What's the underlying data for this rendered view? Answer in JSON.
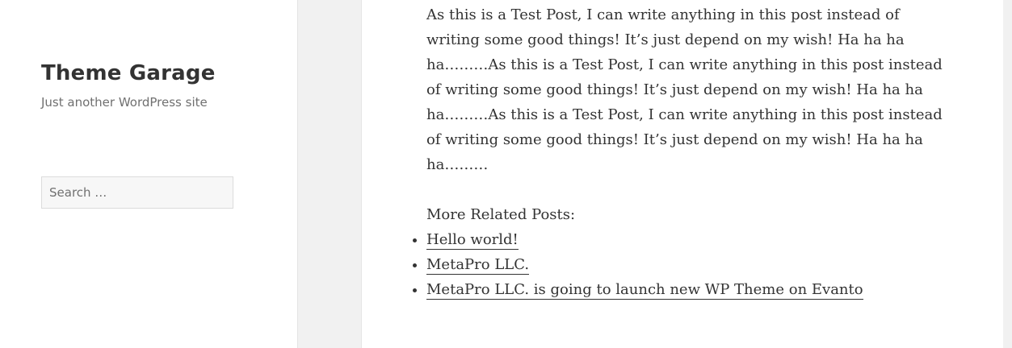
{
  "site": {
    "title": "Theme Garage",
    "description": "Just another WordPress site"
  },
  "search": {
    "placeholder": "Search …"
  },
  "post": {
    "paragraph": "As this is a Test Post, I can write anything in this post instead of writing some good things! It’s just depend on my wish! Ha ha ha ha………As this is a Test Post, I can write anything in this post instead of writing some good things! It’s just depend on my wish! Ha ha ha ha………As this is a Test Post, I can write anything in this post instead of writing some good things! It’s just depend on my wish! Ha ha ha ha………",
    "related_heading": "More Related Posts:",
    "related": [
      {
        "label": "Hello world!"
      },
      {
        "label": "MetaPro LLC."
      },
      {
        "label": "MetaPro LLC. is going to launch new WP Theme on Evanto"
      }
    ]
  },
  "colors": {
    "background": "#f1f1f1",
    "panel": "#ffffff",
    "text": "#333333",
    "muted": "#707070"
  }
}
